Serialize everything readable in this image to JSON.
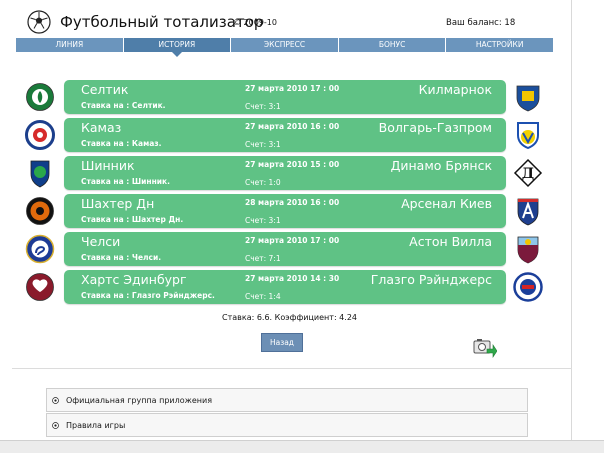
{
  "header": {
    "title": "Футбольный тотализатор",
    "copyright": "© 2009-10",
    "balance": "Ваш баланс: 18"
  },
  "nav": {
    "tabs": [
      {
        "label": "ЛИНИЯ"
      },
      {
        "label": "ИСТОРИЯ",
        "active": true
      },
      {
        "label": "ЭКСПРЕСС"
      },
      {
        "label": "БОНУС"
      },
      {
        "label": "НАСТРОЙКИ"
      }
    ]
  },
  "matches": [
    {
      "home": "Селтик",
      "away": "Килмарнок",
      "date": "27 марта 2010 17 : 00",
      "bet": "Ставка на : Селтик.",
      "score": "Счет: 3:1",
      "home_colors": [
        "#1a7a3a",
        "#ffffff"
      ],
      "away_colors": [
        "#1b4f9c",
        "#f2c500"
      ]
    },
    {
      "home": "Камаз",
      "away": "Волгарь-Газпром",
      "date": "27 марта 2010 16 : 00",
      "bet": "Ставка на : Камаз.",
      "score": "Счет: 3:1",
      "home_colors": [
        "#1c3f8c",
        "#d62b2b"
      ],
      "away_colors": [
        "#1c50b0",
        "#f2d200"
      ]
    },
    {
      "home": "Шинник",
      "away": "Динамо Брянск",
      "date": "27 марта 2010 15 : 00",
      "bet": "Ставка на : Шинник.",
      "score": "Счет: 1:0",
      "home_colors": [
        "#0f3e8a",
        "#2aa84a"
      ],
      "away_colors": [
        "#111111",
        "#ffffff"
      ]
    },
    {
      "home": "Шахтер Дн",
      "away": "Арсенал Киев",
      "date": "28 марта 2010 16 : 00",
      "bet": "Ставка на : Шахтер Дн.",
      "score": "Счет: 3:1",
      "home_colors": [
        "#e06a0c",
        "#111111"
      ],
      "away_colors": [
        "#1f3f8f",
        "#d22d2d"
      ]
    },
    {
      "home": "Челси",
      "away": "Астон Вилла",
      "date": "27 марта 2010 17 : 00",
      "bet": "Ставка на : Челси.",
      "score": "Счет: 7:1",
      "home_colors": [
        "#1d3b95",
        "#ffffff"
      ],
      "away_colors": [
        "#7b1a3c",
        "#8fc6ea"
      ]
    },
    {
      "home": "Хартс Эдинбург",
      "away": "Глазго Рэйнджерс",
      "date": "27 марта 2010 14 : 30",
      "bet": "Ставка на : Глазго Рэйнджерс.",
      "score": "Счет: 1:4",
      "home_colors": [
        "#8a1a2b",
        "#ffffff"
      ],
      "away_colors": [
        "#1b3f9a",
        "#d42424"
      ]
    }
  ],
  "summary": "Ставка: 6.6. Коэффициент: 4.24",
  "back_button": "Назад",
  "links": [
    {
      "label": "Официальная группа приложения"
    },
    {
      "label": "Правила игры"
    }
  ],
  "colors": {
    "match_bar": "#5fc285",
    "nav_tab": "#6b95bd",
    "nav_tab_active": "#4f7ea9",
    "button": "#6c8fb5"
  }
}
